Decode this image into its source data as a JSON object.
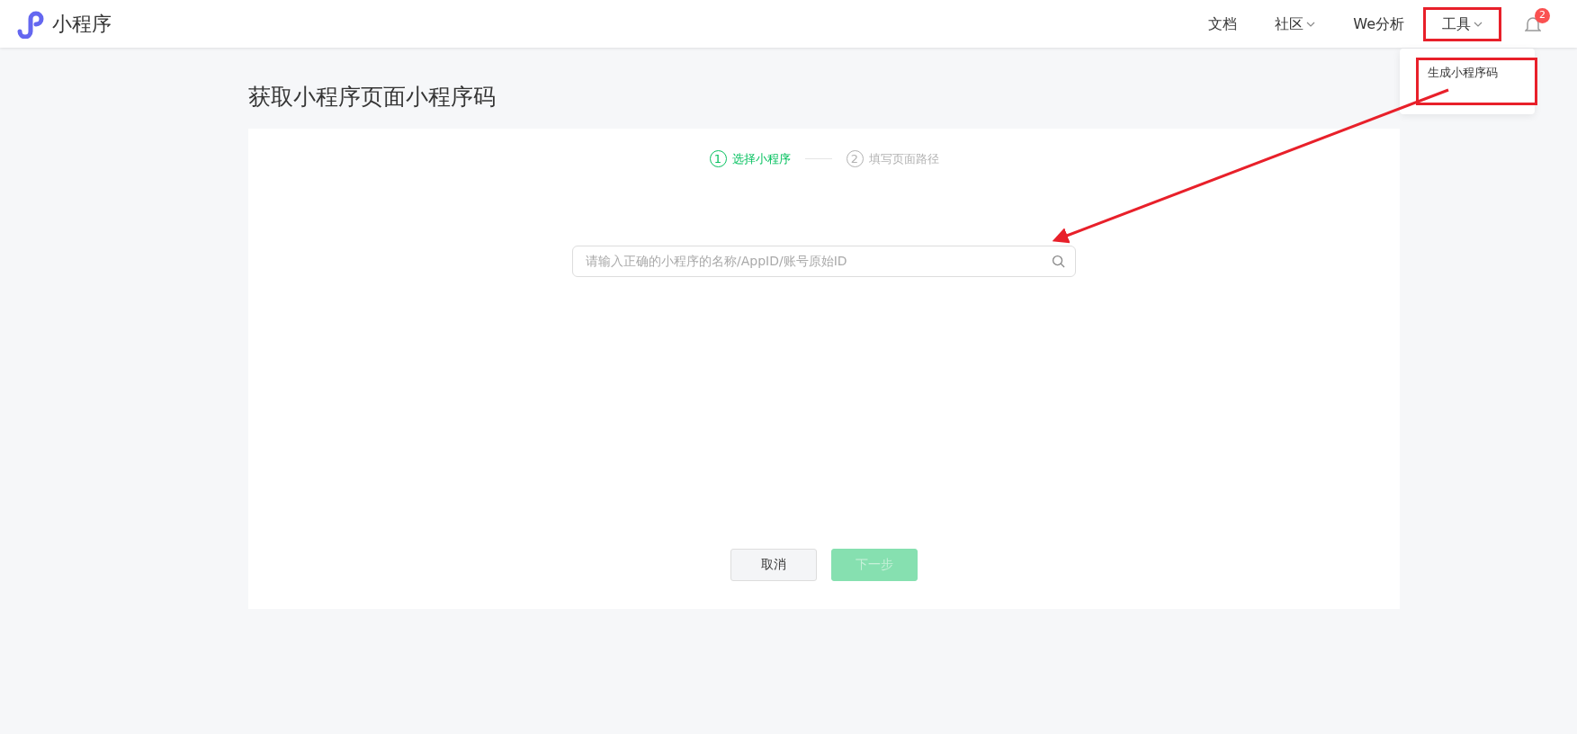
{
  "header": {
    "logo_text": "小程序",
    "nav": [
      {
        "label": "文档",
        "has_caret": false,
        "highlighted": false
      },
      {
        "label": "社区",
        "has_caret": true,
        "highlighted": false
      },
      {
        "label": "We分析",
        "has_caret": false,
        "highlighted": false
      },
      {
        "label": "工具",
        "has_caret": true,
        "highlighted": true,
        "menu": [
          {
            "label": "生成小程序码",
            "highlighted": true
          }
        ]
      }
    ],
    "notification_badge": "2"
  },
  "page_title": "获取小程序页面小程序码",
  "steps": [
    {
      "number": "1",
      "label": "选择小程序",
      "selected": true
    },
    {
      "number": "2",
      "label": "填写页面路径",
      "selected": false
    }
  ],
  "search": {
    "placeholder": "请输入正确的小程序的名称/AppID/账号原始ID"
  },
  "buttons": [
    {
      "label": "取消",
      "kind": "secondary",
      "disabled": false
    },
    {
      "label": "下一步",
      "kind": "primary",
      "disabled": true
    }
  ]
}
